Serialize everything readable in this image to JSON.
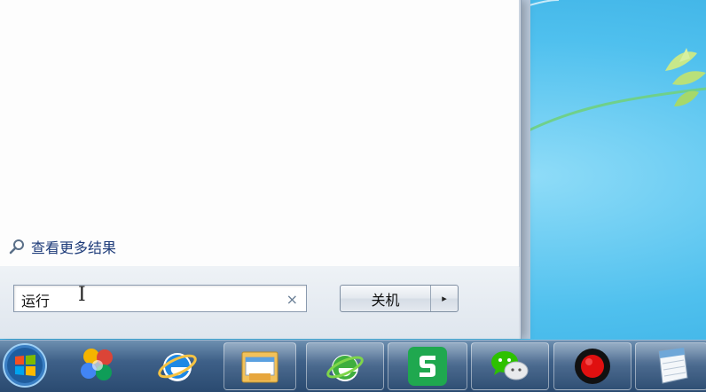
{
  "start_menu": {
    "see_more_results": "查看更多结果",
    "search": {
      "value": "运行",
      "cursor_glyph": "I",
      "clear_glyph": "×"
    },
    "shutdown": {
      "label": "关机",
      "arrow_glyph": "▸"
    }
  },
  "taskbar": {
    "items": [
      {
        "icon": "windows-start-orb-icon"
      },
      {
        "icon": "colorful-app-icon"
      },
      {
        "icon": "internet-explorer-icon"
      },
      {
        "icon": "file-explorer-icon"
      },
      {
        "icon": "green-browser-icon"
      },
      {
        "icon": "wps-spreadsheet-icon"
      },
      {
        "icon": "wechat-icon"
      },
      {
        "icon": "record-icon"
      },
      {
        "icon": "notepad-icon"
      }
    ]
  },
  "colors": {
    "link_blue": "#1e3c7a",
    "wallpaper_blue": "#4fc0ee",
    "taskbar": "#3e6088",
    "wps_green": "#1fa84f",
    "record_red": "#e01010"
  }
}
